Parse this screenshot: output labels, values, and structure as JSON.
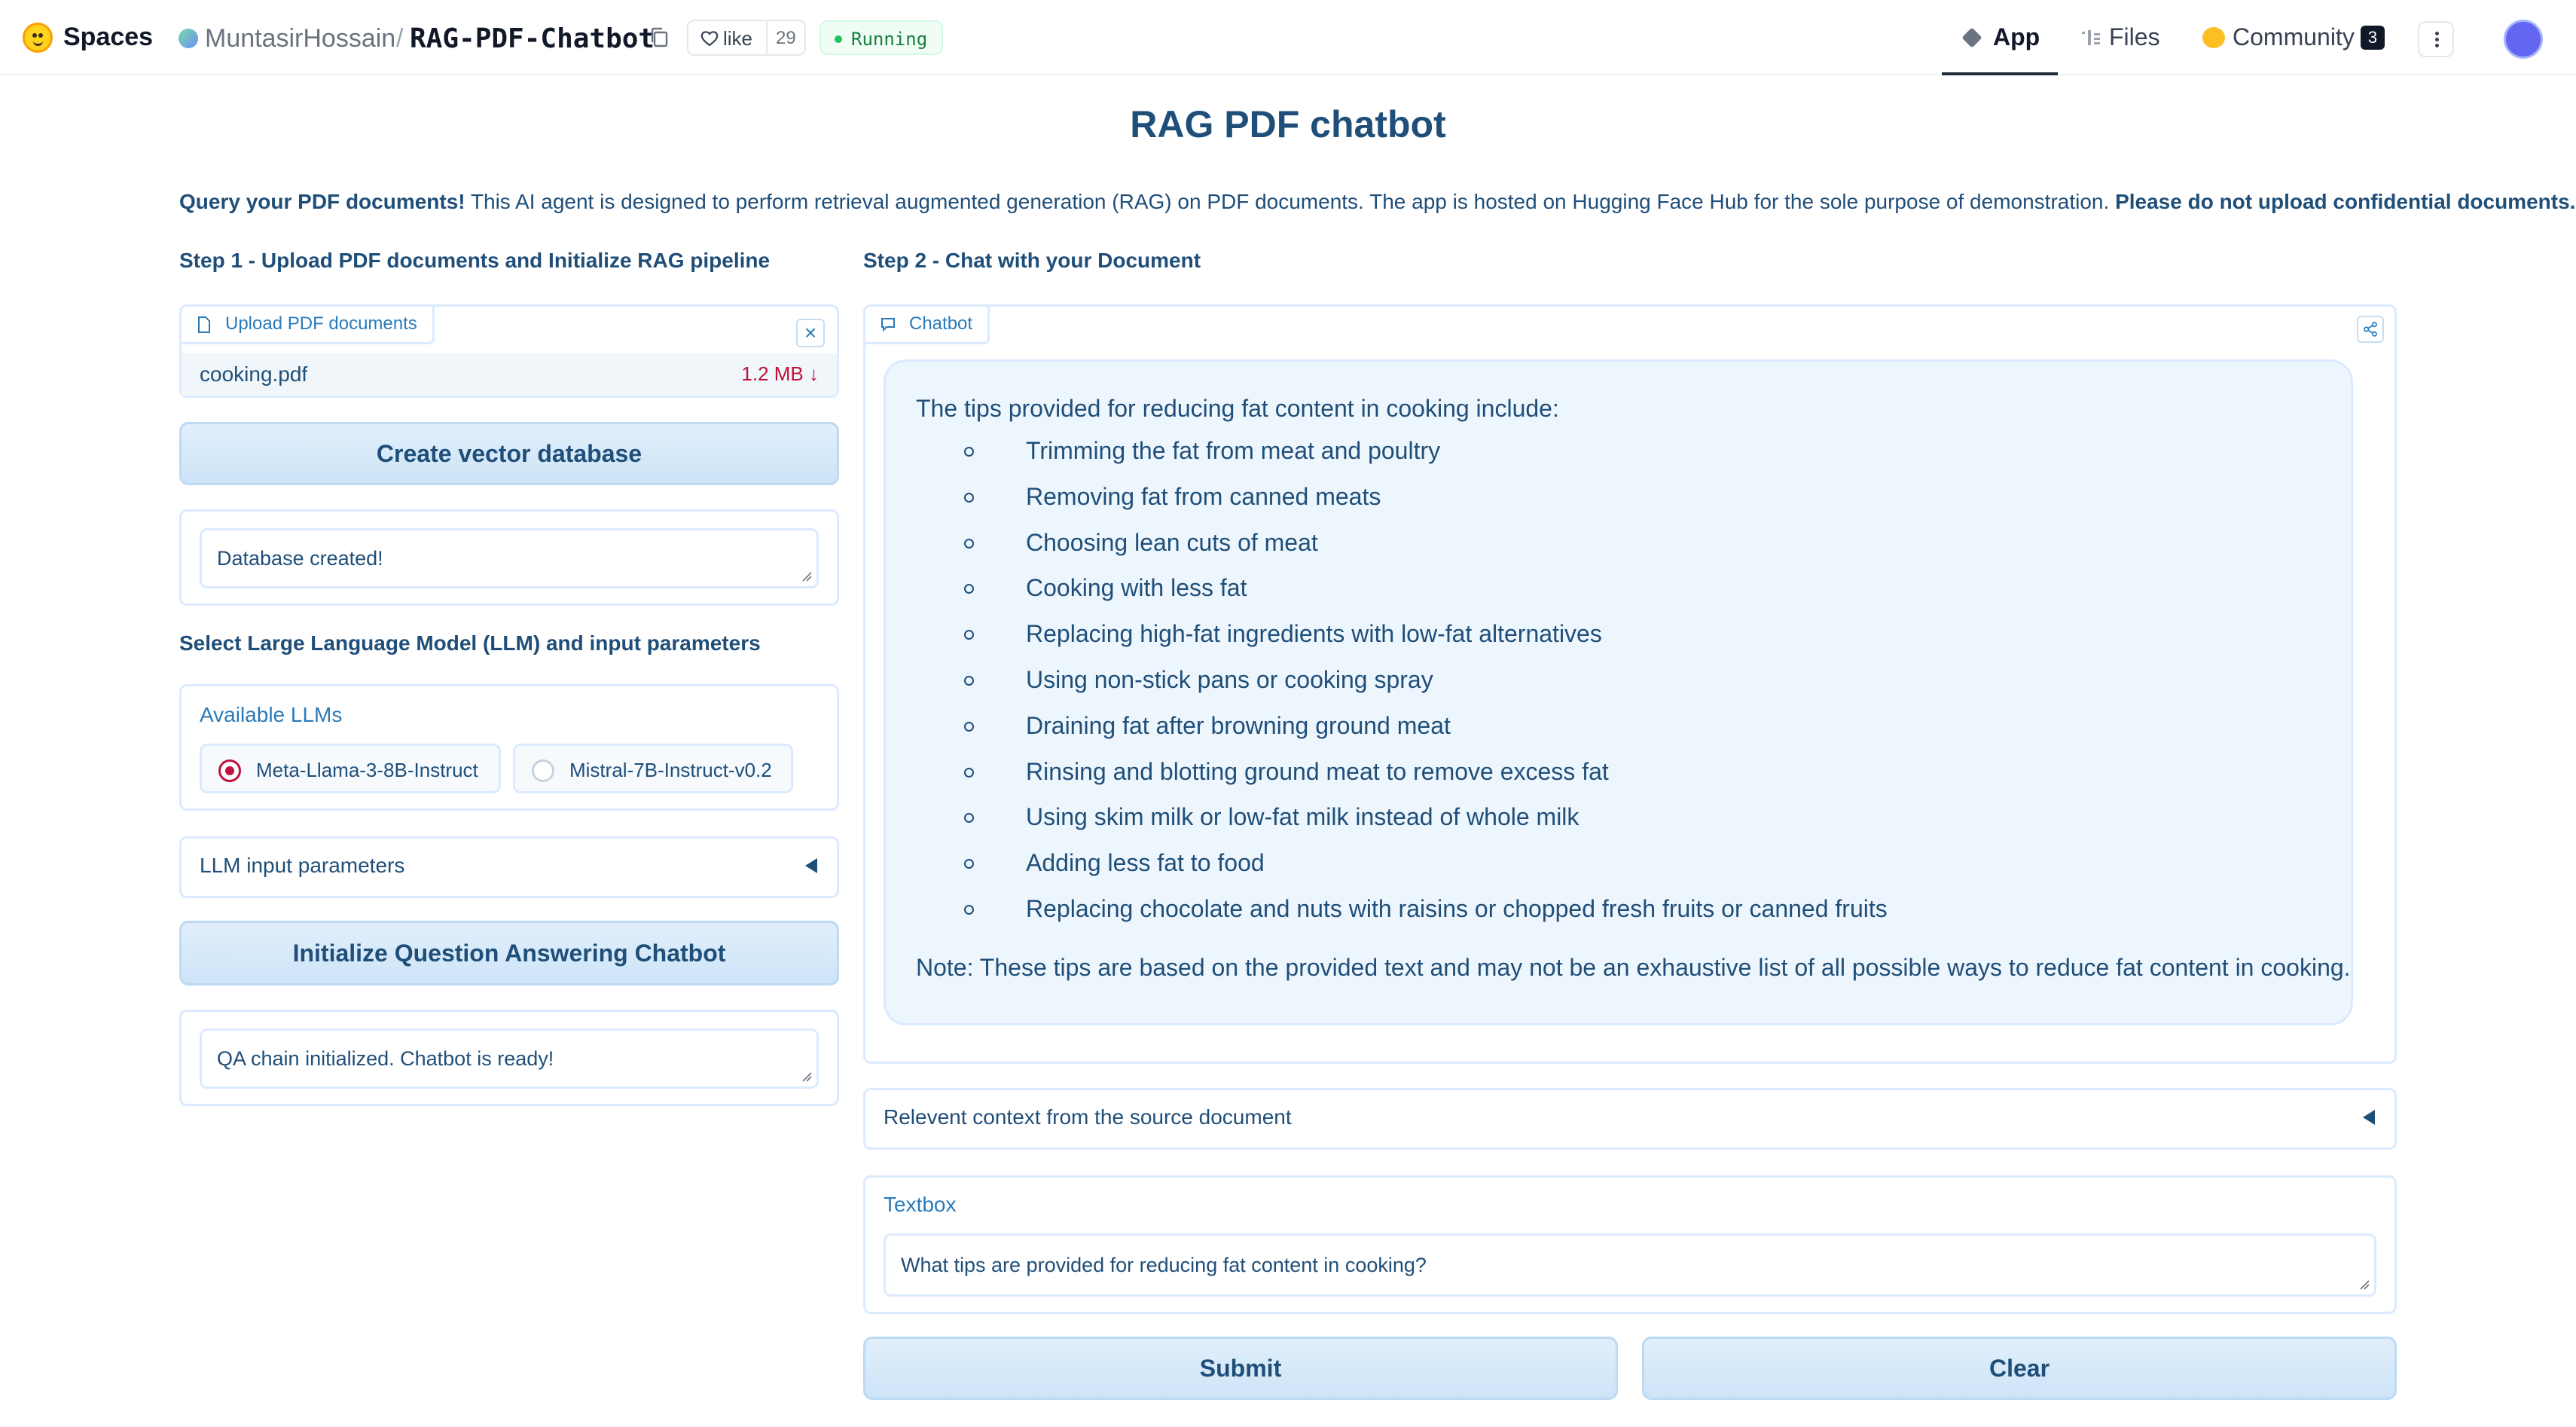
{
  "header": {
    "brand": "Spaces",
    "owner": "MuntasirHossain",
    "separator": "/",
    "repo": "RAG-PDF-Chatbot",
    "like_label": "like",
    "like_count": "29",
    "status": "Running",
    "nav": {
      "app": "App",
      "files": "Files",
      "community": "Community",
      "community_count": "3"
    }
  },
  "page": {
    "title": "RAG PDF chatbot",
    "intro_bold": "Query your PDF documents!",
    "intro_text": " This AI agent is designed to perform retrieval augmented generation (RAG) on PDF documents. The app is hosted on Hugging Face Hub for the sole purpose of demonstration. ",
    "intro_warning": "Please do not upload confidential documents."
  },
  "left": {
    "step1_title": "Step 1 - Upload PDF documents and Initialize RAG pipeline",
    "upload_label": "Upload PDF documents",
    "file_name": "cooking.pdf",
    "file_size": "1.2 MB ↓",
    "create_db_button": "Create vector database",
    "db_status": "Database created!",
    "llm_section_title": "Select Large Language Model (LLM) and input parameters",
    "available_llms_label": "Available LLMs",
    "llm_options": [
      "Meta-Llama-3-8B-Instruct",
      "Mistral-7B-Instruct-v0.2"
    ],
    "llm_selected": "Meta-Llama-3-8B-Instruct",
    "llm_params_label": "LLM input parameters",
    "init_chatbot_button": "Initialize Question Answering Chatbot",
    "qa_status": "QA chain initialized. Chatbot is ready!"
  },
  "right": {
    "step2_title": "Step 2 - Chat with your Document",
    "chatbot_label": "Chatbot",
    "answer_intro": "The tips provided for reducing fat content in cooking include:",
    "tips": [
      "Trimming the fat from meat and poultry",
      "Removing fat from canned meats",
      "Choosing lean cuts of meat",
      "Cooking with less fat",
      "Replacing high-fat ingredients with low-fat alternatives",
      "Using non-stick pans or cooking spray",
      "Draining fat after browning ground meat",
      "Rinsing and blotting ground meat to remove excess fat",
      "Using skim milk or low-fat milk instead of whole milk",
      "Adding less fat to food",
      "Replacing chocolate and nuts with raisins or chopped fresh fruits or canned fruits"
    ],
    "answer_note": "Note: These tips are based on the provided text and may not be an exhaustive list of all possible ways to reduce fat content in cooking.",
    "context_label": "Relevent context from the source document",
    "textbox_label": "Textbox",
    "textbox_value": "What tips are provided for reducing fat content in cooking?",
    "submit_button": "Submit",
    "clear_button": "Clear"
  },
  "colors": {
    "accent": "#1f4e79",
    "label_blue": "#2b7bb9",
    "border": "#dbeafe",
    "button_bg": "#cde4f7",
    "radio_selected": "#be123c",
    "status_green": "#22c55e"
  },
  "icons": [
    "hugging-face-logo",
    "copy-icon",
    "heart-icon",
    "app-icon",
    "files-icon",
    "community-icon",
    "more-icon",
    "file-icon",
    "close-icon",
    "chat-icon",
    "share-icon",
    "caret-left-icon"
  ]
}
